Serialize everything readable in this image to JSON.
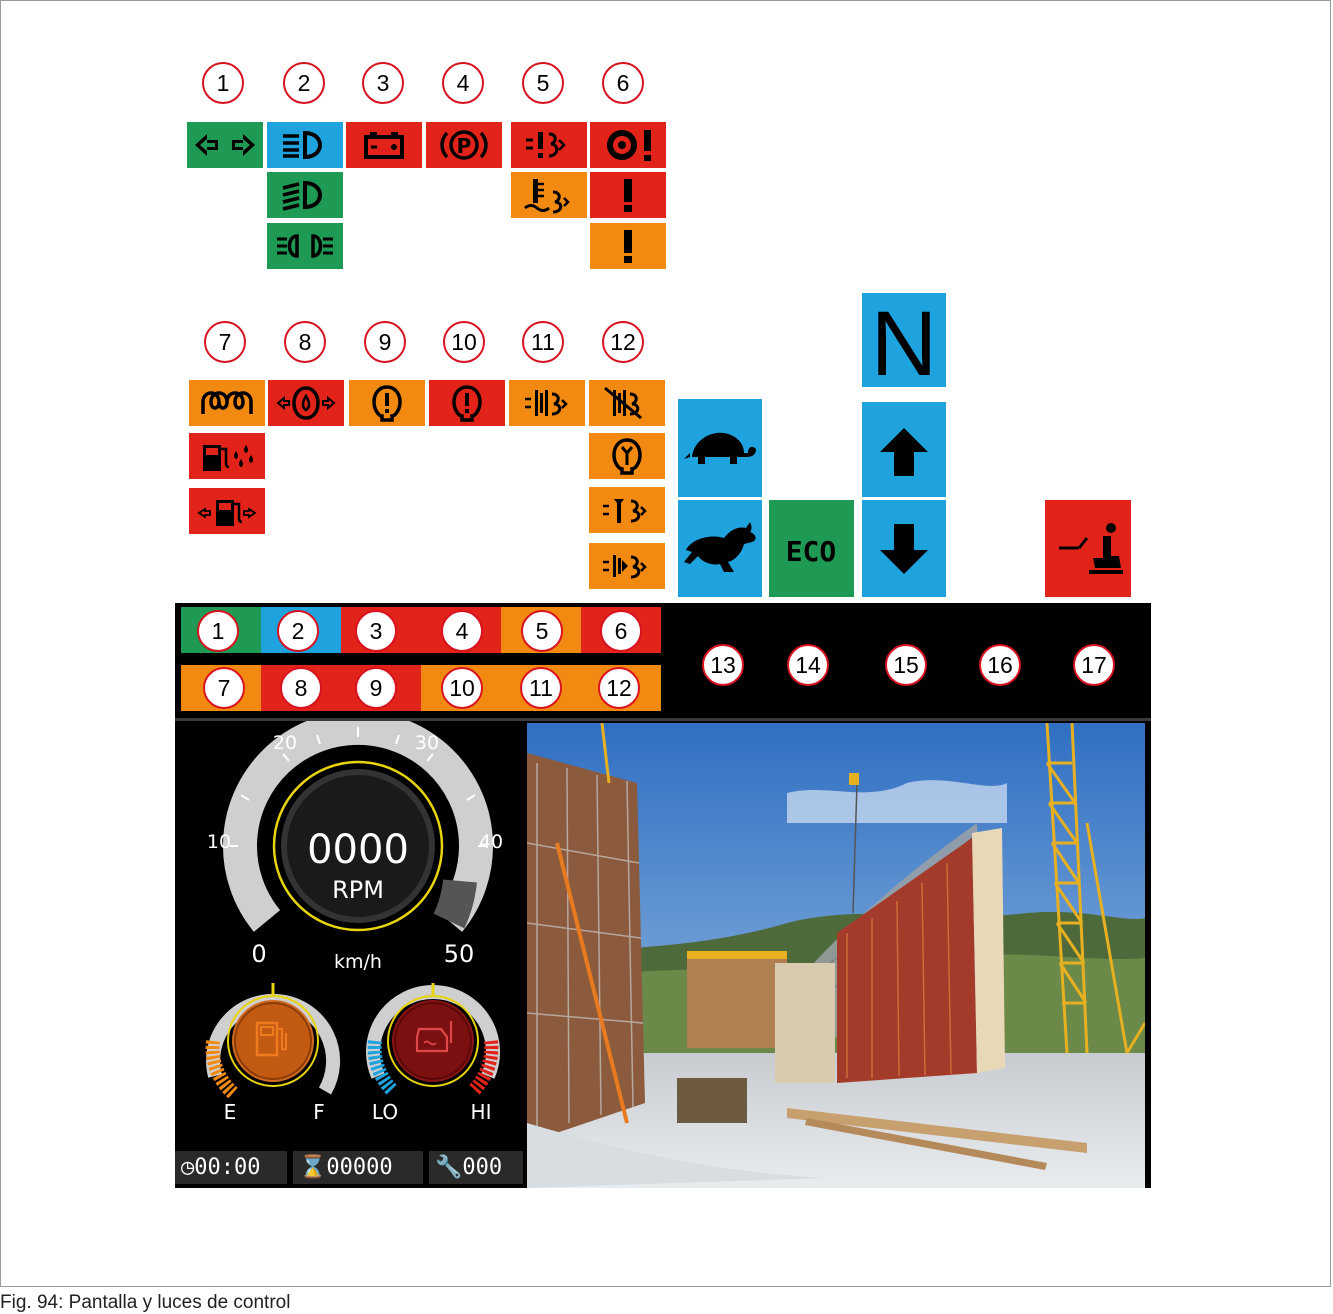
{
  "caption": "Fig. 94: Pantalla y luces de control",
  "callouts_top": [
    "1",
    "2",
    "3",
    "4",
    "5",
    "6"
  ],
  "callouts_mid": [
    "7",
    "8",
    "9",
    "10",
    "11",
    "12"
  ],
  "callouts_strip_top": [
    "1",
    "2",
    "3",
    "4",
    "5",
    "6"
  ],
  "callouts_strip_bottom": [
    "7",
    "8",
    "9",
    "10",
    "11",
    "12"
  ],
  "callouts_right": [
    "13",
    "14",
    "15",
    "16",
    "17"
  ],
  "indicators": {
    "gear_neutral": "N",
    "eco": "ECO"
  },
  "speedometer": {
    "ticks": [
      "0",
      "10",
      "20",
      "30",
      "40",
      "50"
    ],
    "value": "0000",
    "unit_rpm": "RPM",
    "unit_speed": "km/h"
  },
  "fuel_gauge": {
    "low": "E",
    "high": "F"
  },
  "temp_gauge": {
    "low": "LO",
    "high": "HI"
  },
  "status_bar": {
    "clock": "00:00",
    "hours": "00000",
    "service": "000"
  },
  "colors": {
    "green": "#1f9a55",
    "blue": "#1fa3df",
    "red": "#e2231a",
    "orange": "#f28a12"
  }
}
